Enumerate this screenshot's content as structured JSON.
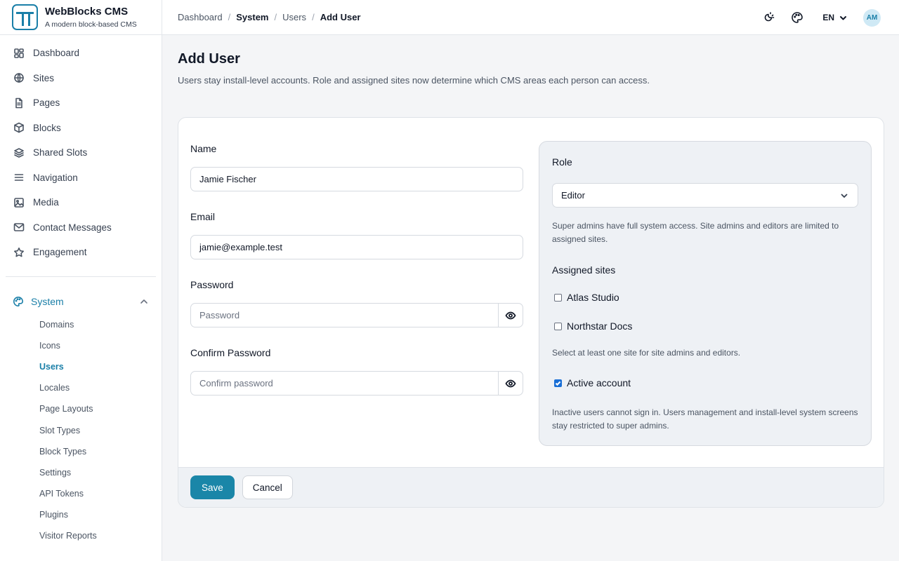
{
  "brand": {
    "name": "WebBlocks CMS",
    "tagline": "A modern block-based CMS"
  },
  "nav": {
    "items": [
      {
        "label": "Dashboard",
        "icon": "dashboard-icon"
      },
      {
        "label": "Sites",
        "icon": "globe-icon"
      },
      {
        "label": "Pages",
        "icon": "file-icon"
      },
      {
        "label": "Blocks",
        "icon": "cube-icon"
      },
      {
        "label": "Shared Slots",
        "icon": "layers-icon"
      },
      {
        "label": "Navigation",
        "icon": "menu-icon"
      },
      {
        "label": "Media",
        "icon": "image-icon"
      },
      {
        "label": "Contact Messages",
        "icon": "mail-icon"
      },
      {
        "label": "Engagement",
        "icon": "star-icon"
      }
    ],
    "system": {
      "label": "System",
      "expanded": true,
      "items": [
        "Domains",
        "Icons",
        "Users",
        "Locales",
        "Page Layouts",
        "Slot Types",
        "Block Types",
        "Settings",
        "API Tokens",
        "Plugins",
        "Visitor Reports"
      ],
      "active": "Users"
    }
  },
  "breadcrumb": [
    "Dashboard",
    "System",
    "Users",
    "Add User"
  ],
  "topbar": {
    "language": "EN",
    "avatar_initials": "AM"
  },
  "page": {
    "title": "Add User",
    "description": "Users stay install-level accounts. Role and assigned sites now determine which CMS areas each person can access."
  },
  "form": {
    "name": {
      "label": "Name",
      "value": "Jamie Fischer"
    },
    "email": {
      "label": "Email",
      "value": "jamie@example.test"
    },
    "password": {
      "label": "Password",
      "placeholder": "Password",
      "value": ""
    },
    "confirm_password": {
      "label": "Confirm Password",
      "placeholder": "Confirm password",
      "value": ""
    },
    "role": {
      "label": "Role",
      "selected": "Editor",
      "help": "Super admins have full system access. Site admins and editors are limited to assigned sites."
    },
    "assigned_sites": {
      "label": "Assigned sites",
      "sites": [
        {
          "label": "Atlas Studio",
          "checked": false
        },
        {
          "label": "Northstar Docs",
          "checked": false
        }
      ],
      "help": "Select at least one site for site admins and editors."
    },
    "active": {
      "label": "Active account",
      "checked": true,
      "help": "Inactive users cannot sign in. Users management and install-level system screens stay restricted to super admins."
    }
  },
  "actions": {
    "save": "Save",
    "cancel": "Cancel"
  },
  "colors": {
    "accent": "#1a7fa8",
    "primary_button": "#1a86a8",
    "checkbox": "#1a6fd6"
  }
}
